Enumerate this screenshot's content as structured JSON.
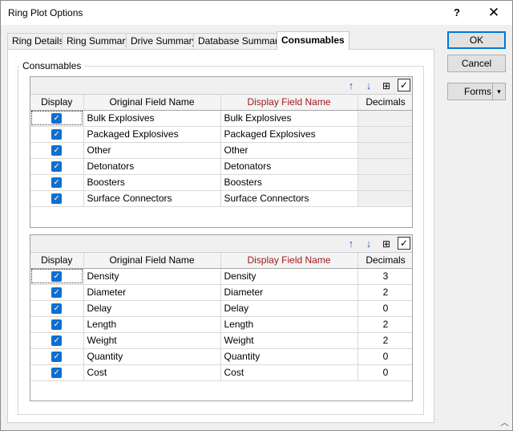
{
  "window": {
    "title": "Ring Plot Options",
    "help_glyph": "?",
    "close_glyph": "✕"
  },
  "tabs": [
    {
      "label": "Ring Details"
    },
    {
      "label": "Ring Summary"
    },
    {
      "label": "Drive Summary"
    },
    {
      "label": "Database Summary"
    },
    {
      "label": "Consumables"
    }
  ],
  "active_tab": "Consumables",
  "group": {
    "label": "Consumables"
  },
  "toolbar": {
    "move_up_glyph": "↑",
    "move_down_glyph": "↓",
    "columns_glyph": "⊞",
    "check_glyph": "✓"
  },
  "grid_headers": {
    "display": "Display",
    "original": "Original Field Name",
    "display_name": "Display Field Name",
    "decimals": "Decimals"
  },
  "grid1": {
    "rows": [
      {
        "original": "Bulk Explosives",
        "display": "Bulk Explosives",
        "decimals": ""
      },
      {
        "original": "Packaged Explosives",
        "display": "Packaged Explosives",
        "decimals": ""
      },
      {
        "original": "Other",
        "display": "Other",
        "decimals": ""
      },
      {
        "original": "Detonators",
        "display": "Detonators",
        "decimals": ""
      },
      {
        "original": "Boosters",
        "display": "Boosters",
        "decimals": ""
      },
      {
        "original": "Surface Connectors",
        "display": "Surface Connectors",
        "decimals": ""
      }
    ]
  },
  "grid2": {
    "rows": [
      {
        "original": "Density",
        "display": "Density",
        "decimals": "3"
      },
      {
        "original": "Diameter",
        "display": "Diameter",
        "decimals": "2"
      },
      {
        "original": "Delay",
        "display": "Delay",
        "decimals": "0"
      },
      {
        "original": "Length",
        "display": "Length",
        "decimals": "2"
      },
      {
        "original": "Weight",
        "display": "Weight",
        "decimals": "2"
      },
      {
        "original": "Quantity",
        "display": "Quantity",
        "decimals": "0"
      },
      {
        "original": "Cost",
        "display": "Cost",
        "decimals": "0"
      }
    ]
  },
  "buttons": {
    "ok": "OK",
    "cancel": "Cancel",
    "forms": "Forms",
    "forms_arrow": "▾"
  },
  "colors": {
    "checkbox": "#0d6fd0",
    "display_header": "#a0191b",
    "accent": "#0078d7"
  }
}
